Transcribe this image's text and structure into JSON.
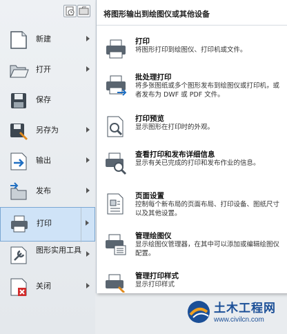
{
  "menu": {
    "items": [
      {
        "label": "新建",
        "icon": "new-document-icon"
      },
      {
        "label": "打开",
        "icon": "open-folder-icon"
      },
      {
        "label": "保存",
        "icon": "save-disk-icon"
      },
      {
        "label": "另存为",
        "icon": "save-as-icon"
      },
      {
        "label": "输出",
        "icon": "export-icon"
      },
      {
        "label": "发布",
        "icon": "publish-icon"
      },
      {
        "label": "打印",
        "icon": "printer-icon",
        "active": true
      },
      {
        "label": "图形实用工具",
        "icon": "drawing-utilities-icon"
      },
      {
        "label": "关闭",
        "icon": "close-document-icon"
      }
    ]
  },
  "panel": {
    "title": "将图形输出到绘图仪或其他设备",
    "entries": [
      {
        "title": "打印",
        "desc": "将图形打印到绘图仪、打印机或文件。",
        "icon": "printer-icon"
      },
      {
        "title": "批处理打印",
        "desc": "将多张图纸或多个图形发布到绘图仪或打印机，或者发布为 DWF 或 PDF 文件。",
        "icon": "batch-plot-icon"
      },
      {
        "title": "打印预览",
        "desc": "显示图形在打印时的外观。",
        "icon": "plot-preview-icon"
      },
      {
        "title": "查看打印和发布详细信息",
        "desc": "显示有关已完成的打印和发布作业的信息。",
        "icon": "plot-details-icon"
      },
      {
        "title": "页面设置",
        "desc": "控制每个新布局的页面布局、打印设备、图纸尺寸以及其他设置。",
        "icon": "page-setup-icon"
      },
      {
        "title": "管理绘图仪",
        "desc": "显示绘图仪管理器，在其中可以添加或编辑绘图仪配置。",
        "icon": "plotter-manager-icon"
      },
      {
        "title": "管理打印样式",
        "desc": "显示打印样式",
        "icon": "plot-style-icon"
      }
    ]
  },
  "watermark": {
    "title": "土木工程网",
    "url": "www.civilcn.com"
  }
}
